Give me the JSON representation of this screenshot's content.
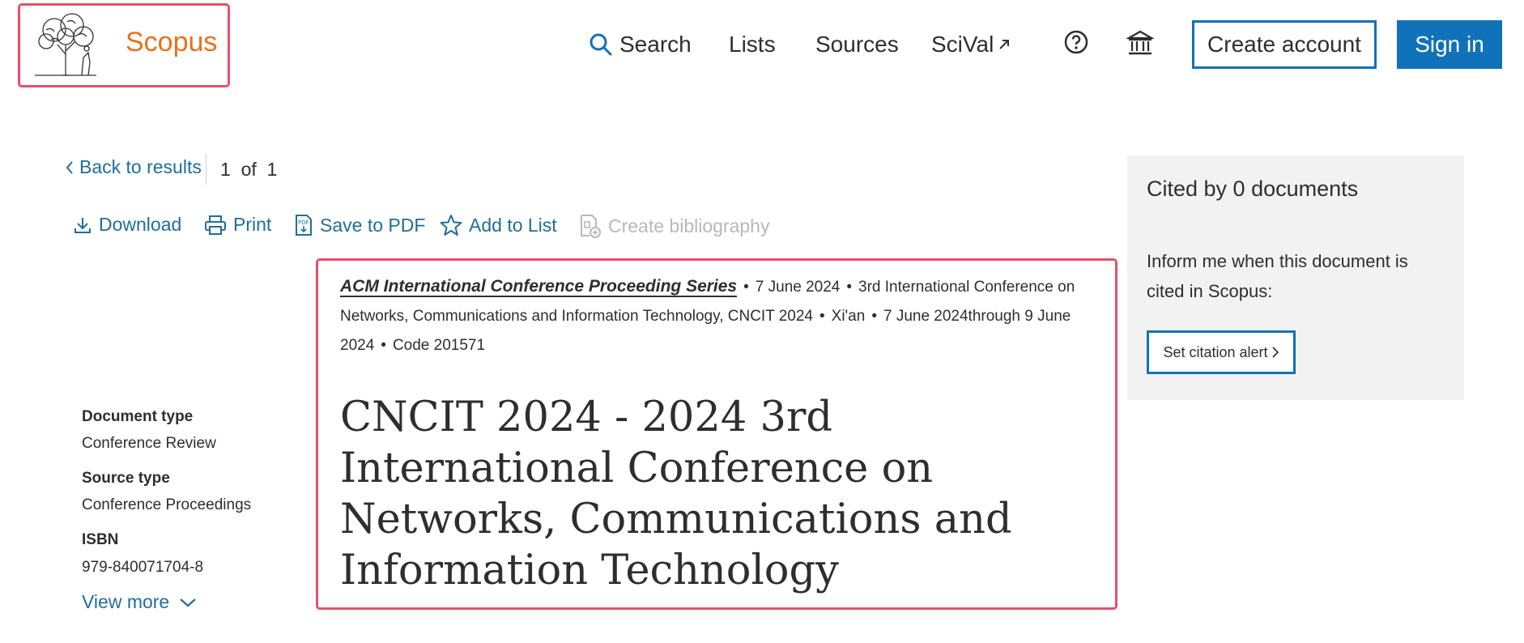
{
  "header": {
    "brand": "Scopus",
    "nav": {
      "search": "Search",
      "lists": "Lists",
      "sources": "Sources",
      "scival": "SciVal"
    },
    "create_account": "Create account",
    "sign_in": "Sign in"
  },
  "results_nav": {
    "back": "Back to results",
    "pager": "1  of  1"
  },
  "toolbar": {
    "download": "Download",
    "print": "Print",
    "save_pdf": "Save to PDF",
    "add_list": "Add to List",
    "create_bibliography": "Create bibliography"
  },
  "source": {
    "series": "ACM International Conference Proceeding Series",
    "date": "7 June 2024",
    "conference": "3rd International Conference on Networks, Communications and Information Technology, CNCIT 2024",
    "location": "Xi'an",
    "dates_range": "7 June 2024through 9 June 2024",
    "code": "Code 201571"
  },
  "document": {
    "title": "CNCIT 2024 - 2024 3rd International Conference on Networks, Communications and Information Technology"
  },
  "meta": {
    "doc_type_label": "Document type",
    "doc_type_value": "Conference Review",
    "source_type_label": "Source type",
    "source_type_value": "Conference Proceedings",
    "isbn_label": "ISBN",
    "isbn_value": "979-840071704-8",
    "view_more": "View more"
  },
  "cited": {
    "title": "Cited by 0 documents",
    "text": "Inform me when this document is cited in Scopus:",
    "alert_button": "Set citation alert"
  },
  "colors": {
    "brand_orange": "#e9711c",
    "primary_blue": "#1072ba",
    "link_blue": "#1e6f9b",
    "highlight_red": "#e8506a"
  }
}
